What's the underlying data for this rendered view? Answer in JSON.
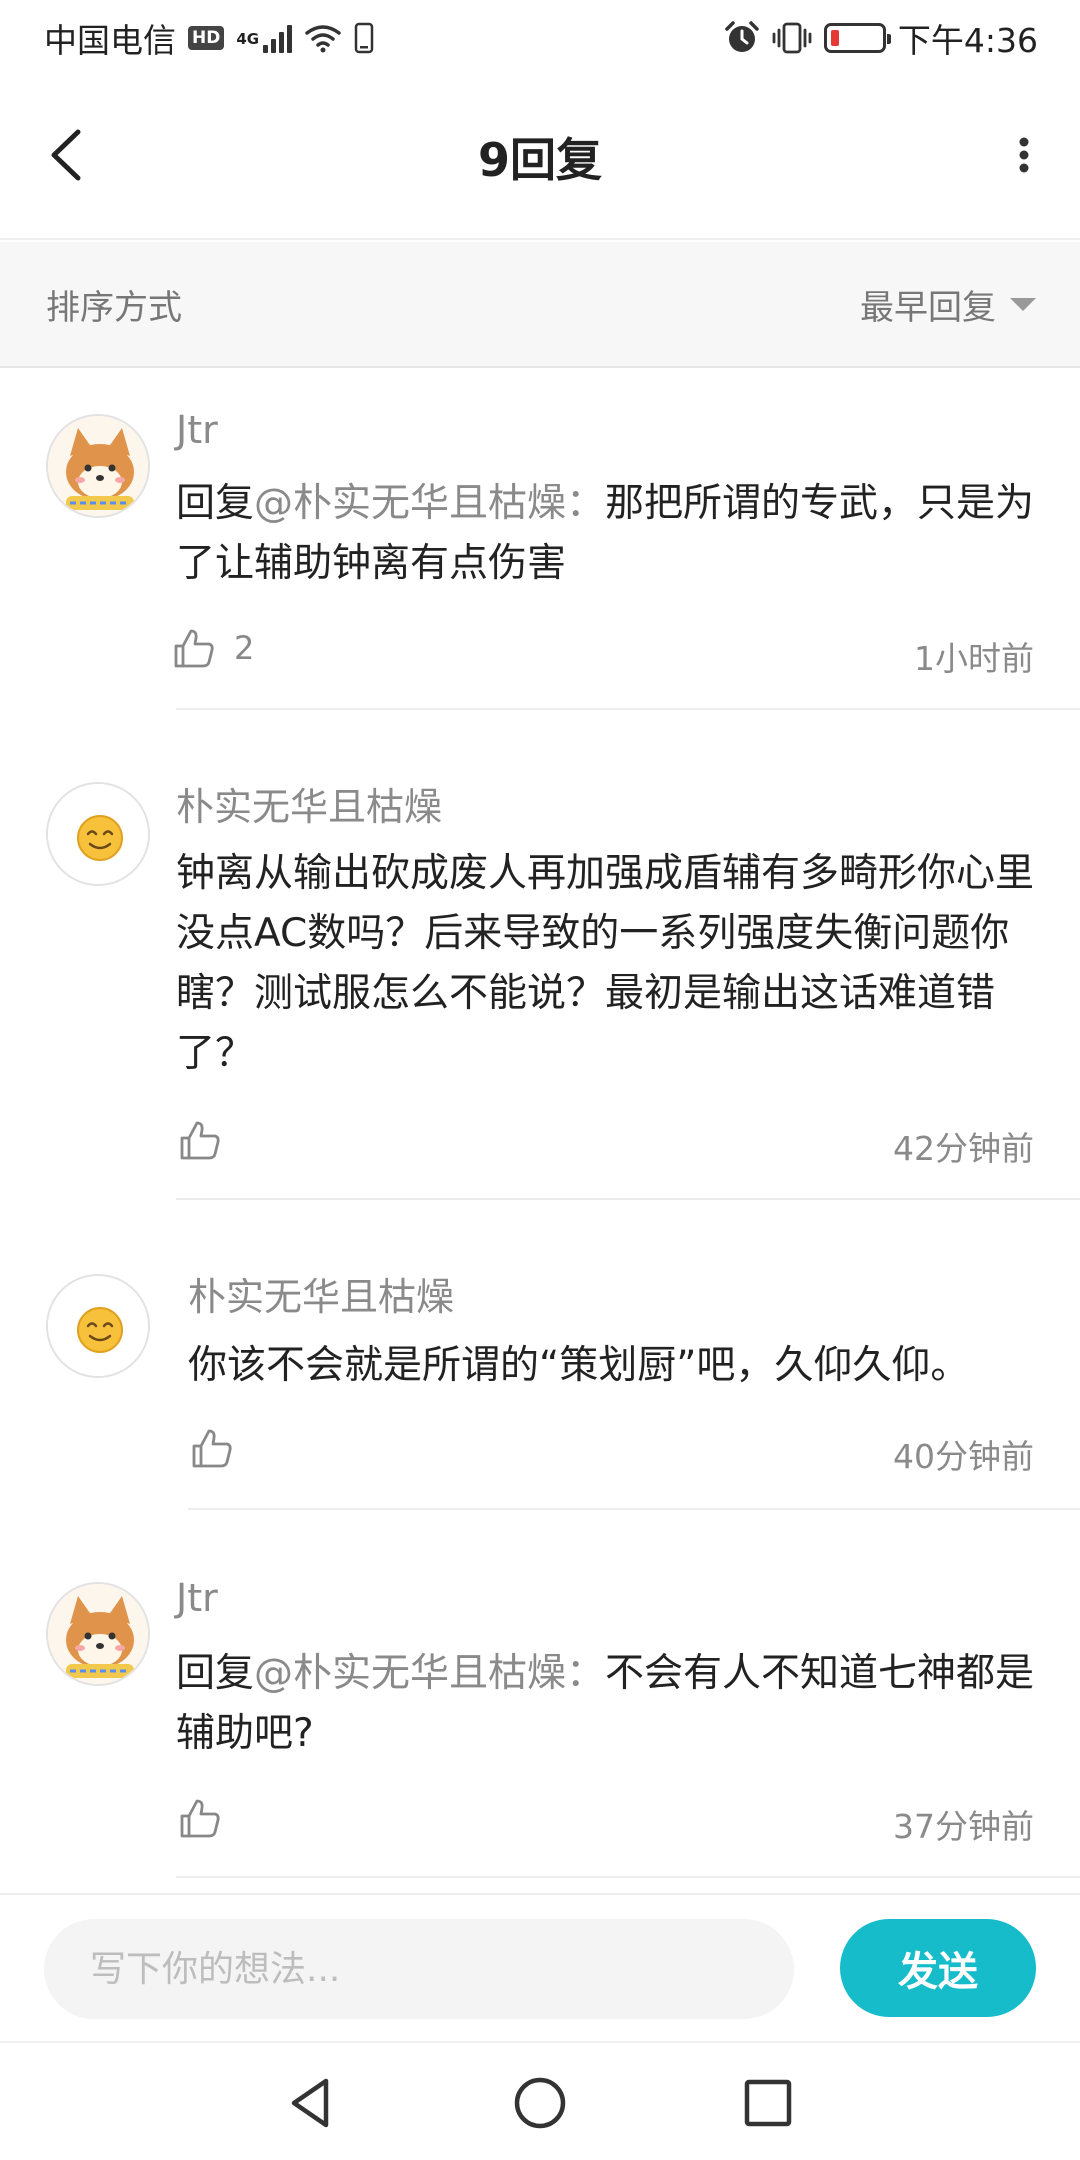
{
  "status_bar": {
    "carrier": "中国电信",
    "hd_badge": "HD",
    "network": "4G",
    "time": "下午4:36",
    "battery_level": 0.15,
    "battery_color": "#e53935",
    "icons": [
      "signal-icon",
      "wifi-icon",
      "phone-icon",
      "alarm-icon",
      "vibrate-icon",
      "battery-icon"
    ]
  },
  "header": {
    "title": "9回复",
    "back_icon": "back-arrow-icon",
    "more_icon": "more-vertical-icon"
  },
  "sort": {
    "label": "排序方式",
    "selected": "最早回复"
  },
  "comments": [
    {
      "user": "Jtr",
      "avatar": "shiba-avatar",
      "reply_prefix": "回复",
      "mention": "@朴实无华且枯燥",
      "colon": "：",
      "text": "那把所谓的专武，只是为了让辅助钟离有点伤害",
      "likes": "2",
      "time": "1小时前"
    },
    {
      "user": "朴实无华且枯燥",
      "avatar": "smiley-avatar",
      "text": "钟离从输出砍成废人再加强成盾辅有多畸形你心里没点AC数吗？后来导致的一系列强度失衡问题你瞎？测试服怎么不能说？最初是输出这话难道错了？",
      "likes": "",
      "time": "42分钟前"
    },
    {
      "user": "朴实无华且枯燥",
      "avatar": "smiley-avatar",
      "text": "你该不会就是所谓的“策划厨”吧，久仰久仰。",
      "likes": "",
      "time": "40分钟前"
    },
    {
      "user": "Jtr",
      "avatar": "shiba-avatar",
      "reply_prefix": "回复",
      "mention": "@朴实无华且枯燥",
      "colon": "：",
      "text": "不会有人不知道七神都是辅助吧?",
      "likes": "",
      "time": "37分钟前"
    }
  ],
  "input_bar": {
    "placeholder": "写下你的想法...",
    "send_label": "发送",
    "send_color": "#17bccb"
  },
  "nav_bar": {
    "icons": [
      "back-triangle-icon",
      "home-circle-icon",
      "recents-square-icon"
    ]
  }
}
